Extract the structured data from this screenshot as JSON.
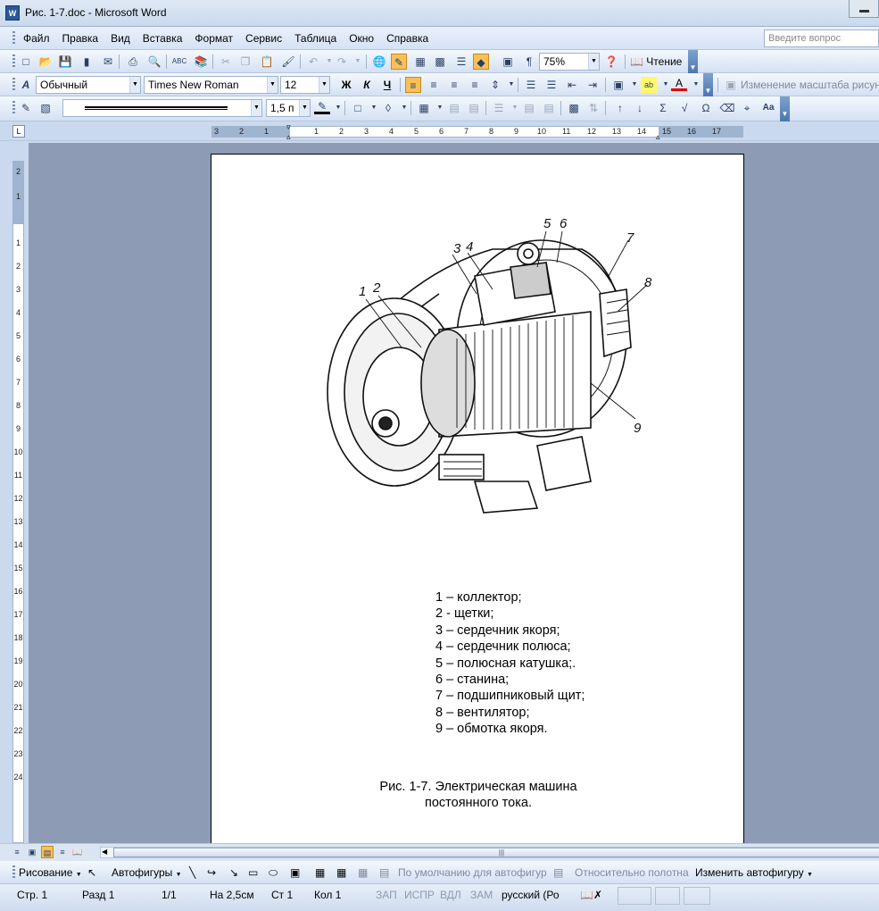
{
  "window": {
    "title": "Рис. 1-7.doc - Microsoft Word",
    "app_icon": "W"
  },
  "menu": {
    "items": [
      "Файл",
      "Правка",
      "Вид",
      "Вставка",
      "Формат",
      "Сервис",
      "Таблица",
      "Окно",
      "Справка"
    ],
    "ask_placeholder": "Введите вопрос"
  },
  "toolbar_standard": {
    "zoom": "75%",
    "reading_label": "Чтение"
  },
  "toolbar_formatting": {
    "style": "Обычный",
    "font": "Times New Roman",
    "size": "12",
    "bold": "Ж",
    "italic": "К",
    "underline": "Ч",
    "picture_scale_label": "Изменение масштаба рисун"
  },
  "toolbar_drawing_format": {
    "line_width": "1,5 п",
    "sigma": "Σ",
    "omega": "Ω",
    "font_label": "Aa"
  },
  "ruler": {
    "h_labels": [
      "3",
      "2",
      "1",
      "",
      "1",
      "2",
      "3",
      "4",
      "5",
      "6",
      "7",
      "8",
      "9",
      "10",
      "11",
      "12",
      "13",
      "14",
      "15",
      "16",
      "17"
    ],
    "v_labels": [
      "2",
      "1",
      "",
      "1",
      "2",
      "3",
      "4",
      "5",
      "6",
      "7",
      "8",
      "9",
      "10",
      "11",
      "12",
      "13",
      "14",
      "15",
      "16",
      "17",
      "18",
      "19",
      "20",
      "21",
      "22",
      "23",
      "24"
    ]
  },
  "document": {
    "figure_labels": [
      "1",
      "2",
      "3",
      "4",
      "5",
      "6",
      "7",
      "8",
      "9"
    ],
    "legend": [
      "1 – коллектор;",
      "2  - щетки;",
      "3  – сердечник якоря;",
      "4  – сердечник полюса;",
      "5  – полюсная катушка;.",
      "6  – станина;",
      "7  – подшипниковый щит;",
      "8  – вентилятор;",
      "9  – обмотка якоря."
    ],
    "caption_line1": "Рис. 1-7. Электрическая  машина",
    "caption_line2": "постоянного тока."
  },
  "drawing_bar": {
    "drawing": "Рисование",
    "autoshapes": "Автофигуры",
    "default_shape": "По умолчанию для автофигур",
    "relative_canvas": "Относительно полотна",
    "change_shape": "Изменить автофигуру"
  },
  "status": {
    "page": "Стр.  1",
    "section": "Разд  1",
    "pages": "1/1",
    "at": "На 2,5см",
    "line": "Ст  1",
    "col": "Кол  1",
    "rec": "ЗАП",
    "trk": "ИСПР",
    "ext": "ВДЛ",
    "ovr": "ЗАМ",
    "language": "русский (Ро"
  }
}
